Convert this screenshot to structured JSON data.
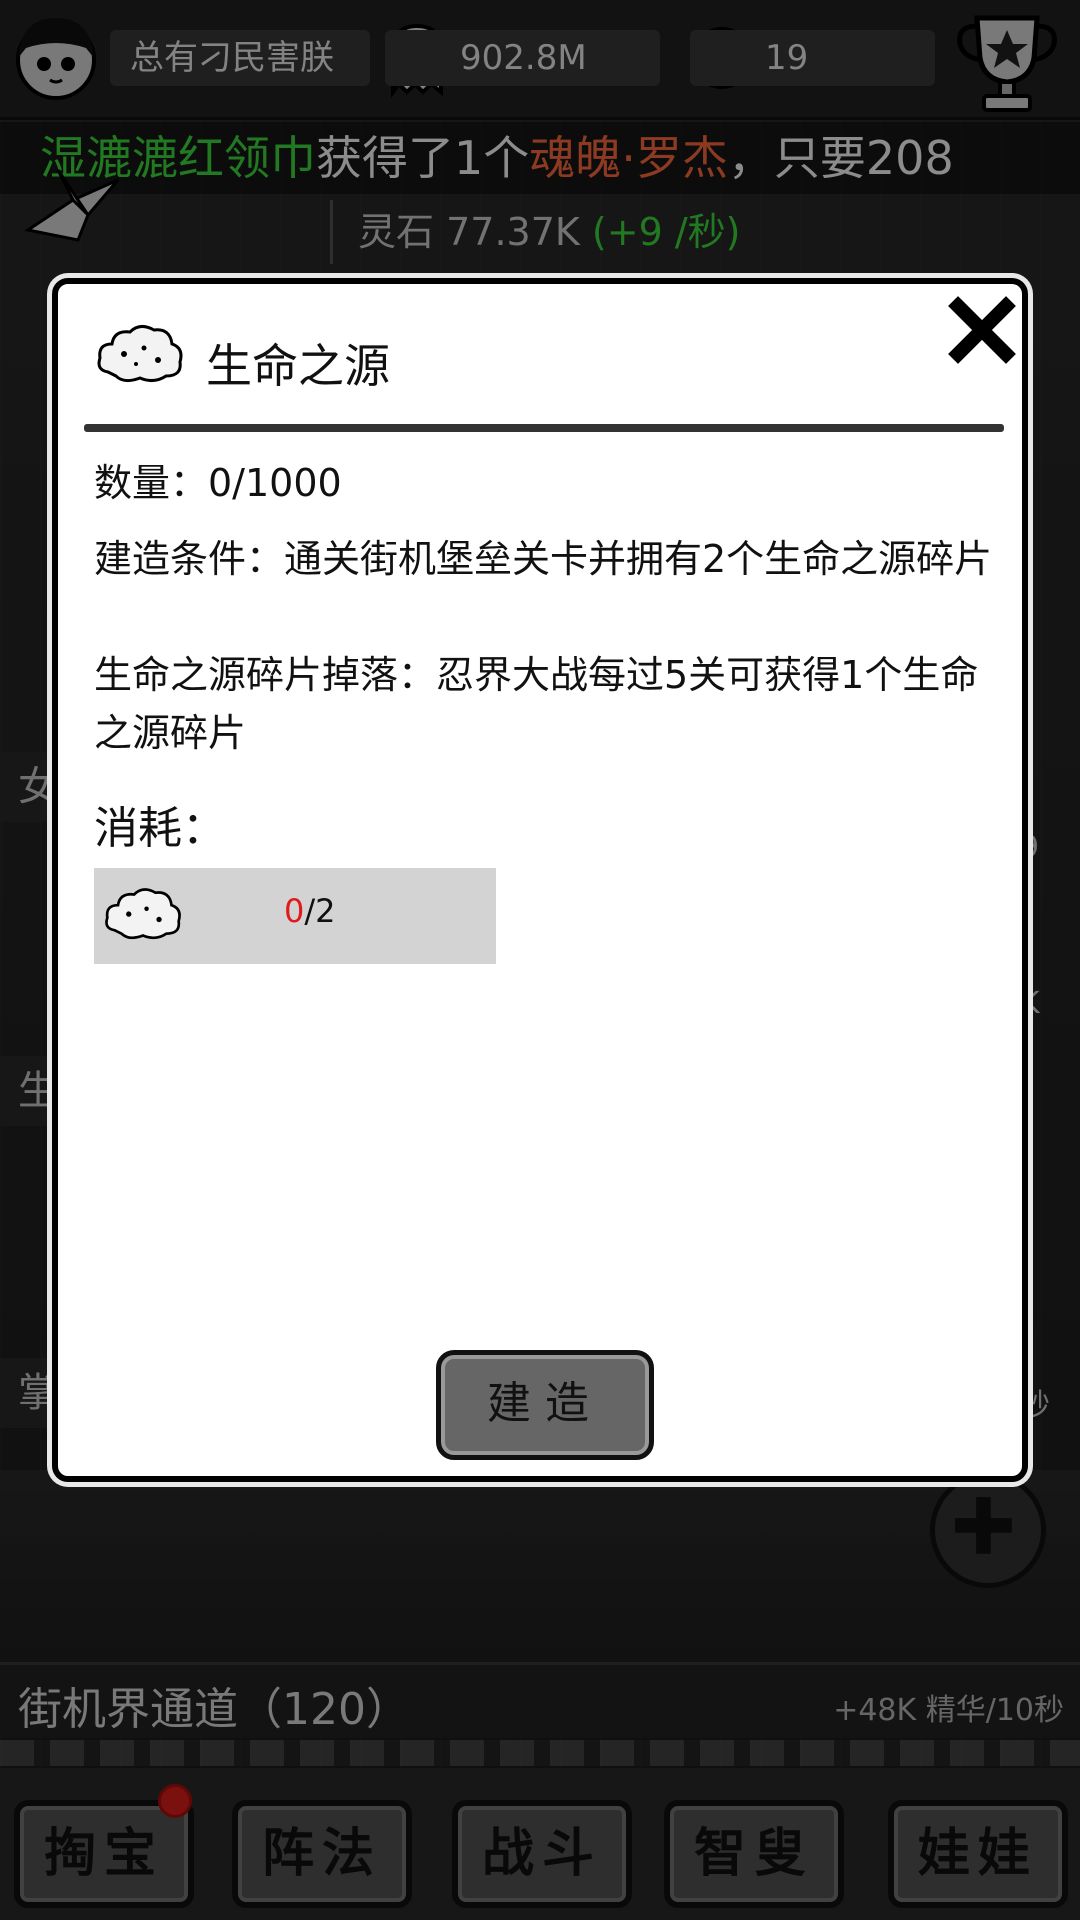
{
  "header": {
    "player_name": "总有刁民害朕",
    "ghost_amount": "902.8M",
    "coin_amount": "19"
  },
  "ticker": {
    "name": "湿漉漉红领巾",
    "middle": "获得了1个",
    "item": "魂魄·罗杰",
    "tail": "，只要208"
  },
  "resources": {
    "stone_label": "灵石",
    "stone_value": "77.37K",
    "stone_rate": "(+9 /秒)"
  },
  "background": {
    "side_label_1": "女",
    "side_label_2": "生",
    "side_label_3": "掌",
    "right_stub_1": "9",
    "right_stub_2": "K",
    "right_stub_3": "秒",
    "channel_name": "街机界通道（120）",
    "channel_rate": "+48K 精华/10秒"
  },
  "modal": {
    "title": "生命之源",
    "quantity": "数量：0/1000",
    "condition": "建造条件：通关街机堡垒关卡并拥有2个生命之源碎片",
    "drop": "生命之源碎片掉落：忍界大战每过5关可获得1个生命之源碎片",
    "consume_label": "消耗：",
    "consume_have": "0",
    "consume_need": "/2",
    "build_label": "建造"
  },
  "bottom_nav": [
    {
      "label": "掏宝"
    },
    {
      "label": "阵法"
    },
    {
      "label": "战斗"
    },
    {
      "label": "智叟"
    },
    {
      "label": "娃娃"
    }
  ],
  "colors": {
    "ticker_name": "#3ddc3d",
    "ticker_item": "#ff6a3d",
    "consume_have": "#e01b1b",
    "badge": "#e0201a"
  }
}
